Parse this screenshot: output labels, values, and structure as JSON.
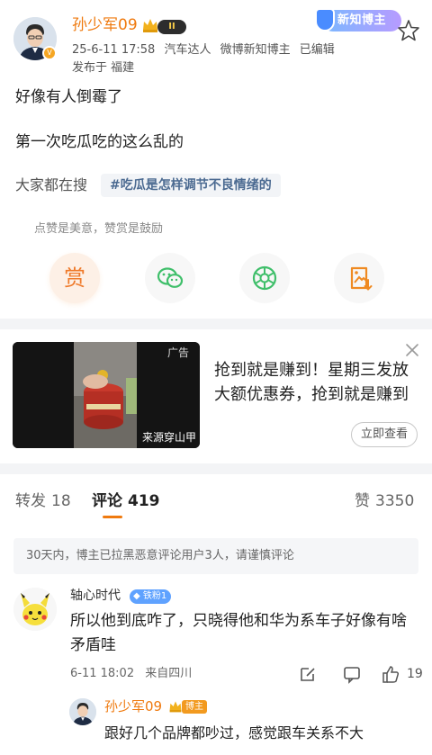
{
  "post": {
    "author": "孙少军09",
    "level_badge": "II",
    "timestamp": "25-6-11 17:58",
    "tags": [
      "汽车达人",
      "微博新知博主",
      "已编辑"
    ],
    "location": "发布于 福建",
    "category_badge": "新知博主",
    "lines": [
      "好像有人倒霉了",
      "第一次吃瓜吃的这么乱的"
    ],
    "search_label": "大家都在搜",
    "search_topic": "#吃瓜是怎样调节不良情绪的",
    "like_hint": "点赞是美意，赞赏是鼓励",
    "reward_label": "赏",
    "actions": [
      "reward-icon",
      "wechat-icon",
      "moments-icon",
      "save-image-icon"
    ]
  },
  "ad": {
    "label": "广告",
    "source": "来源穿山甲",
    "title": "抢到就是赚到！星期三发放大额优惠券，抢到就是赚到",
    "cta": "立即查看"
  },
  "tabs": {
    "repost_label": "转发",
    "repost_count": "18",
    "comments_label": "评论",
    "comments_count": "419",
    "likes_label": "赞",
    "likes_count": "3350"
  },
  "notice": "30天内，博主已拉黑恶意评论用户3人，请谨慎评论",
  "comment": {
    "user": "轴心时代",
    "badge": "铁粉1",
    "text": "所以他到底咋了，只晓得他和华为系车子好像有啥矛盾哇",
    "time": "6-11 18:02",
    "location": "来自四川",
    "likes": "19"
  },
  "reply": {
    "user": "孙少军09",
    "badge": "博主",
    "text": "跟好几个品牌都吵过，感觉跟车关系不大"
  },
  "colors": {
    "accent": "#ef7a0f",
    "link": "#4b6a91",
    "divider": "#f3f4f6",
    "fan_badge": "#5fa2ff"
  }
}
